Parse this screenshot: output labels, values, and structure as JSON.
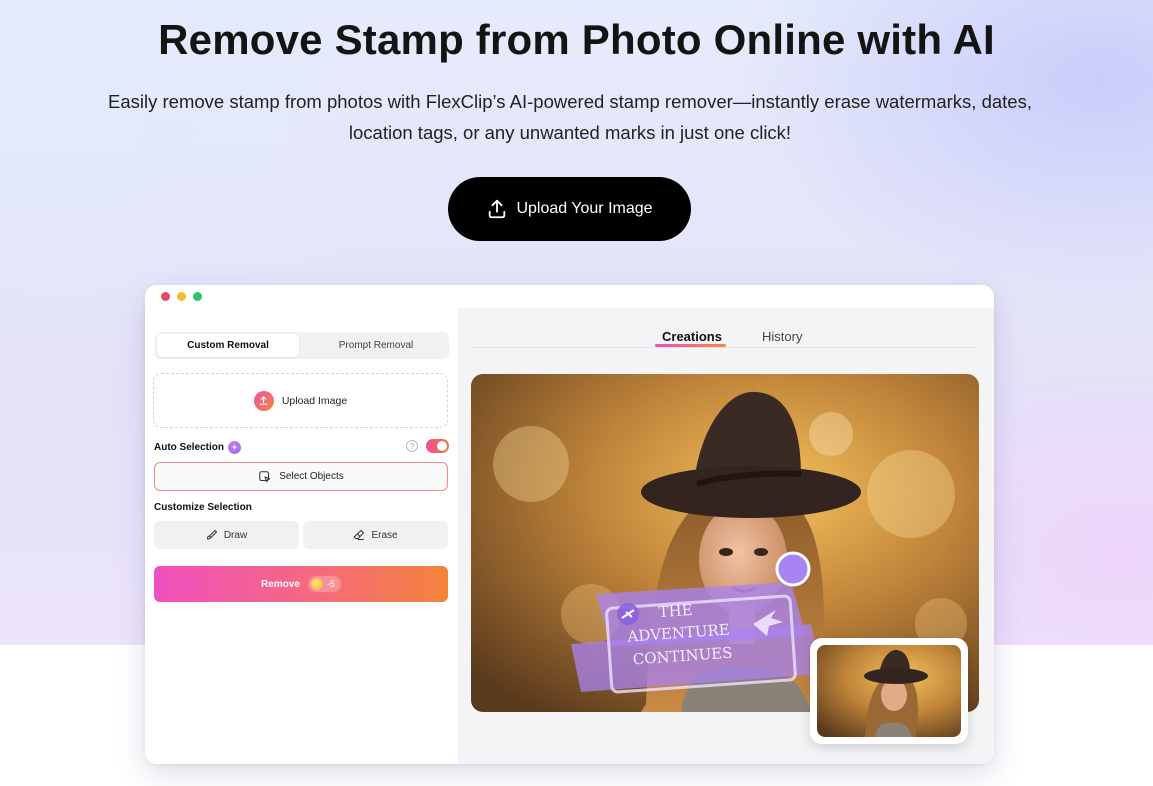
{
  "hero": {
    "title": "Remove Stamp from Photo Online with AI",
    "subtitle": "Easily remove stamp from photos with FlexClip’s AI-powered stamp remover—instantly erase watermarks, dates, location tags, or any unwanted marks in just one click!",
    "cta_label": "Upload Your Image",
    "cta_icon": "upload-icon"
  },
  "app": {
    "window_controls": [
      "close",
      "minimize",
      "maximize"
    ],
    "left_panel": {
      "modes": [
        {
          "label": "Custom Removal",
          "active": true
        },
        {
          "label": "Prompt Removal",
          "active": false
        }
      ],
      "upload_label": "Upload Image",
      "auto_selection_label": "Auto Selection",
      "auto_selection_enabled": true,
      "help_glyph": "?",
      "select_objects_label": "Select Objects",
      "customize_label": "Customize Selection",
      "draw_label": "Draw",
      "erase_label": "Erase",
      "remove_label": "Remove",
      "remove_cost": "-5"
    },
    "right_panel": {
      "tabs": [
        {
          "label": "Creations",
          "active": true
        },
        {
          "label": "History",
          "active": false
        }
      ],
      "stamp_text": [
        "THE",
        "ADVENTURE",
        "CONTINUES"
      ]
    }
  },
  "colors": {
    "accent_start": "#f04fc0",
    "accent_end": "#f5833a",
    "stamp_purple": "#a883f2",
    "cta_bg": "#000000"
  }
}
